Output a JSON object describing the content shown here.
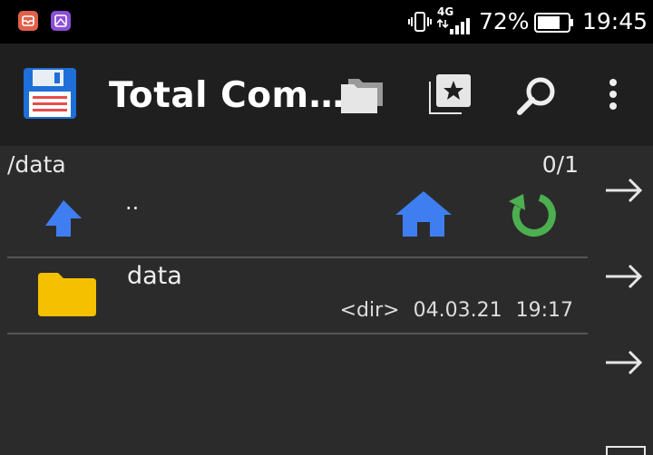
{
  "statusbar": {
    "network": "4G",
    "battery": "72%",
    "time": "19:45",
    "notification_icons": [
      "mail-icon",
      "gallery-icon"
    ]
  },
  "toolbar": {
    "title": "Total Com…",
    "icons": [
      "floppy-disk-icon",
      "folders-icon",
      "bookmarks-icon",
      "search-icon",
      "overflow-menu-icon"
    ]
  },
  "panel": {
    "path": "/data",
    "count": "0/1",
    "parent_label": "..",
    "files": [
      {
        "name": "data",
        "type": "<dir>",
        "date": "04.03.21",
        "time": "19:17"
      }
    ]
  },
  "colors": {
    "background": "#2b2b2b",
    "toolbar": "#1f1f1f",
    "accent_blue": "#3f7ef0",
    "accent_green": "#4caf50",
    "folder": "#f5c000"
  }
}
